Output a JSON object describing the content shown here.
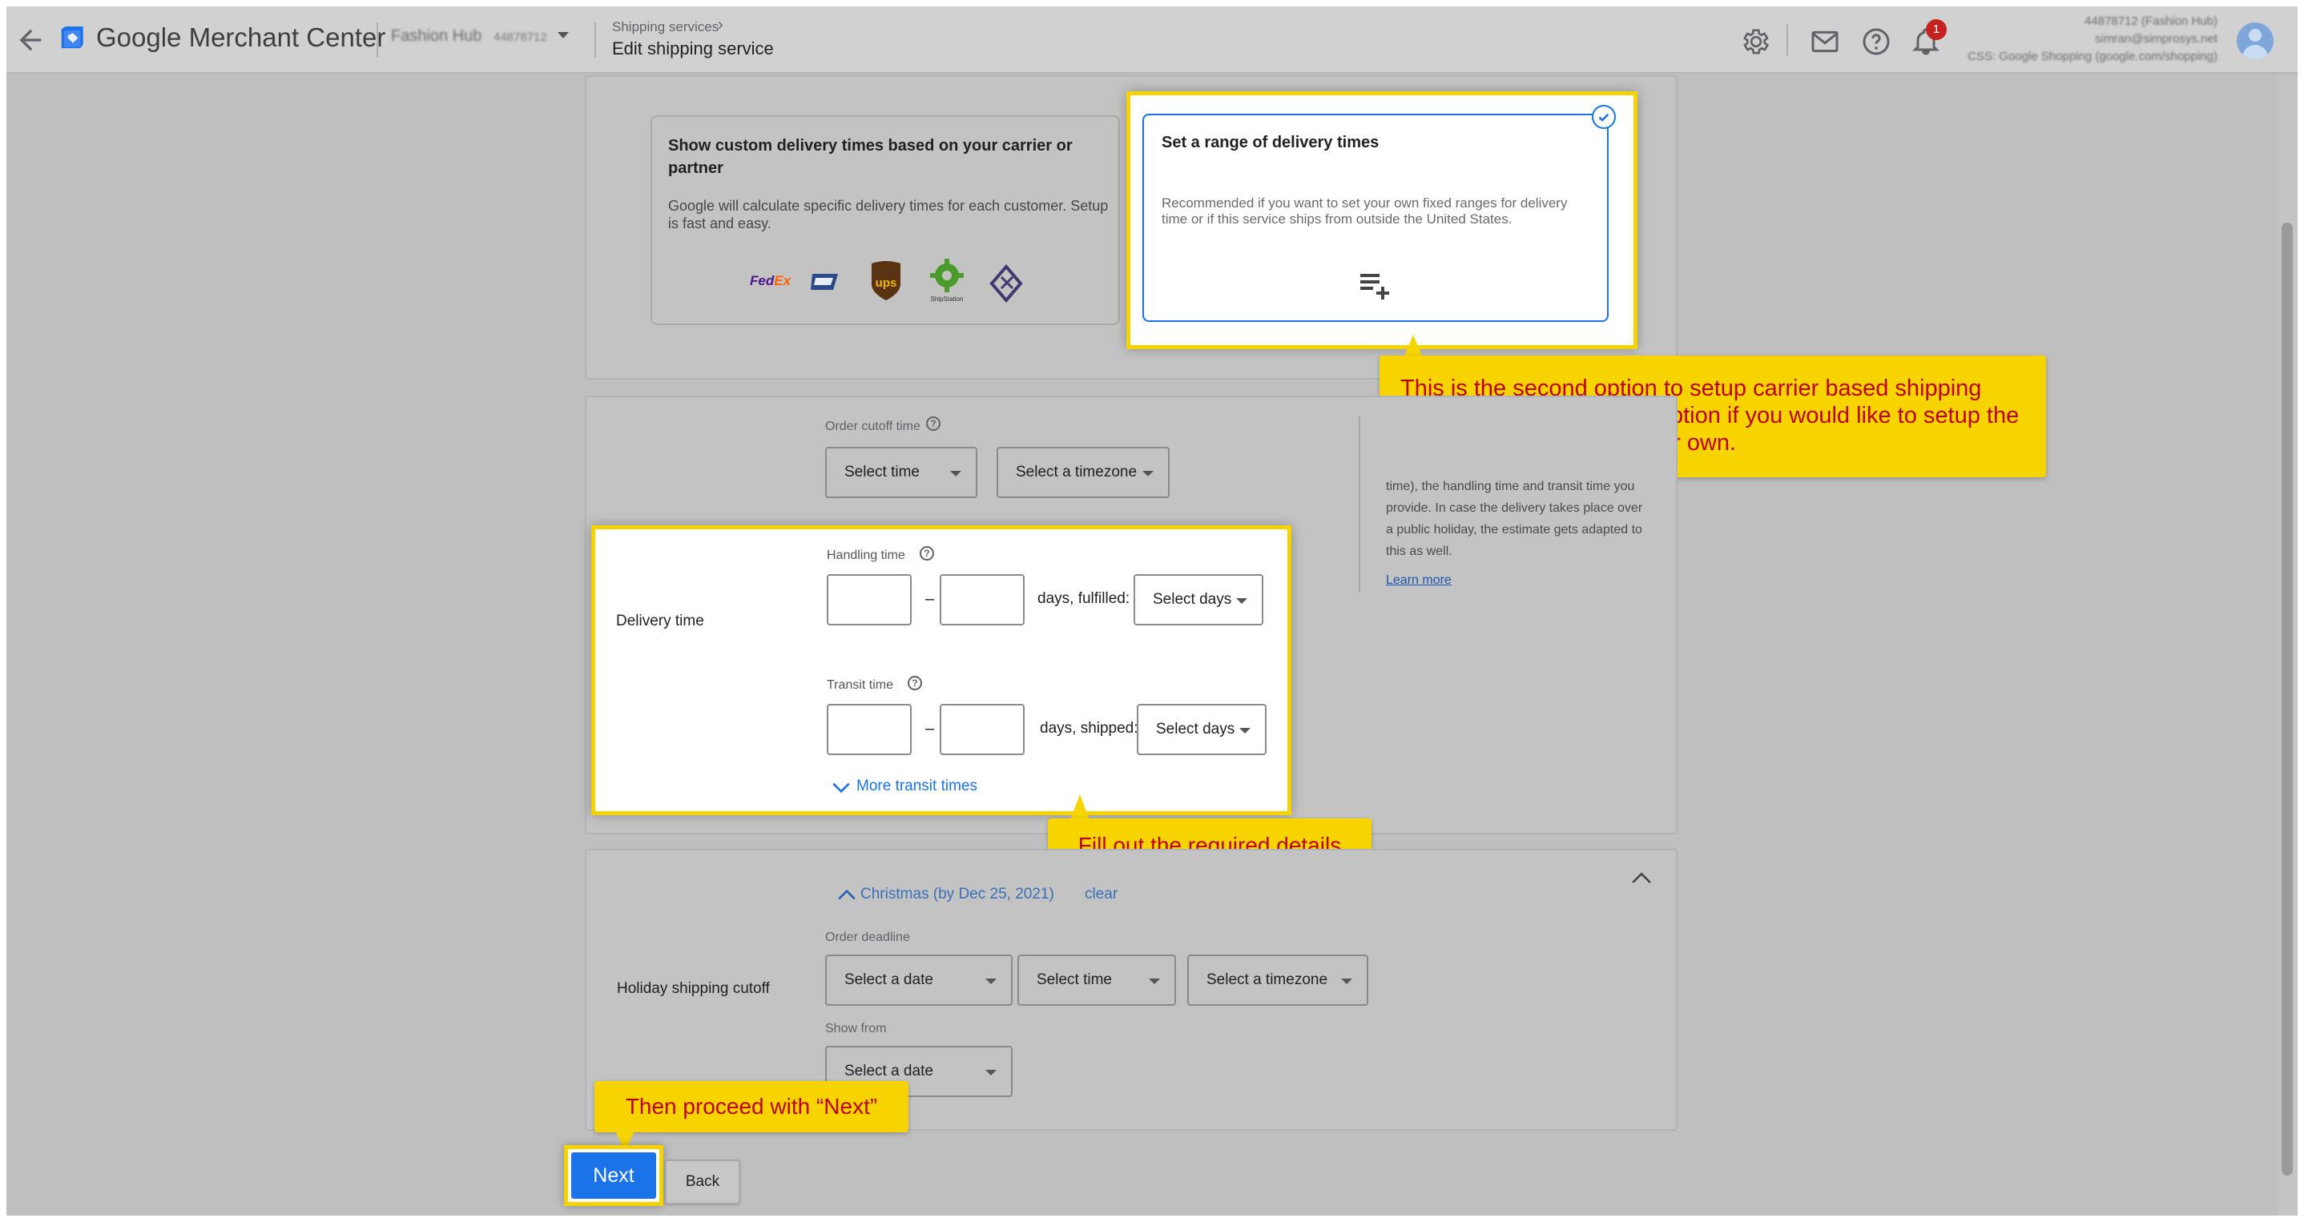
{
  "header": {
    "brand": "Google Merchant Center",
    "account_name": "Fashion Hub",
    "account_id": "44878712",
    "breadcrumb_parent": "Shipping services",
    "breadcrumb_current": "Edit shipping service",
    "notification_count": "1",
    "user_line1": "44878712 (Fashion Hub)",
    "user_line2": "simran@simprosys.net",
    "user_line3": "CSS: Google Shopping (google.com/shopping)"
  },
  "delivery_options": {
    "custom": {
      "title": "Show custom delivery times based on your carrier or partner",
      "description": "Google will calculate specific delivery times for each customer. Setup is fast and easy.",
      "carriers": [
        "FedEx",
        "USPS",
        "UPS",
        "ShipStation",
        "Partner"
      ]
    },
    "range": {
      "title": "Set a range of delivery times",
      "description": "Recommended if you want to set your own fixed ranges for delivery time or if this service ships from outside the United States."
    }
  },
  "delivery_time": {
    "section_label": "Delivery time",
    "order_cutoff_label": "Order cutoff time",
    "select_time": "Select time",
    "select_timezone": "Select a timezone",
    "handling_label": "Handling time",
    "handling_suffix": "days, fulfilled:",
    "handling_days": "Select days",
    "transit_label": "Transit time",
    "transit_suffix": "days, shipped:",
    "transit_days": "Select days",
    "more_transit": "More transit times",
    "dash": "–",
    "side_text": "time), the handling time and transit time you provide. In case the delivery takes place over a public holiday, the estimate gets adapted to this as well.",
    "learn_more": "Learn more"
  },
  "holiday": {
    "section_label": "Holiday shipping cutoff",
    "holiday_name": "Christmas (by Dec 25, 2021)",
    "clear": "clear",
    "order_deadline_label": "Order deadline",
    "select_date": "Select a date",
    "select_time": "Select time",
    "select_timezone": "Select a timezone",
    "show_from_label": "Show from",
    "show_from_date": "Select a date"
  },
  "footer": {
    "next": "Next",
    "back": "Back"
  },
  "annotations": {
    "range_note": "This is the second option to setup carrier based shipping setting. You can use this option if you would like to setup the delivery time range on your own.",
    "fill_note": "Fill out the required details",
    "next_note": "Then proceed with “Next”"
  },
  "colors": {
    "highlight": "#f5d300",
    "callout_text": "#c00000",
    "primary": "#1a73e8"
  }
}
